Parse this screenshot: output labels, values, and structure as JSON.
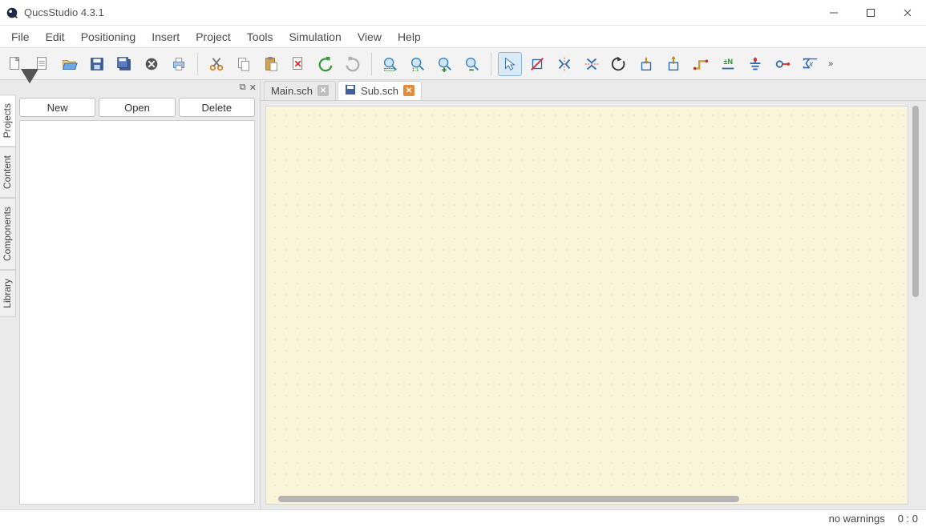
{
  "app": {
    "title": "QucsStudio 4.3.1"
  },
  "menu": {
    "file": "File",
    "edit": "Edit",
    "positioning": "Positioning",
    "insert": "Insert",
    "project": "Project",
    "tools": "Tools",
    "simulation": "Simulation",
    "view": "View",
    "help": "Help"
  },
  "toolbar_icons": {
    "new_doc": "new-document-icon",
    "new_doc_text": "new-text-document-icon",
    "open": "open-folder-icon",
    "save": "save-icon",
    "save_all": "save-all-icon",
    "close": "close-doc-icon",
    "print": "print-icon",
    "cut": "cut-icon",
    "copy": "copy-icon",
    "paste": "paste-icon",
    "delete": "delete-icon",
    "undo": "undo-icon",
    "redo": "redo-icon",
    "zoom_fit": "zoom-fit-icon",
    "zoom_actual": "zoom-actual-icon",
    "zoom_in": "zoom-in-icon",
    "zoom_out": "zoom-out-icon",
    "select": "select-pointer-icon",
    "deactivate": "deactivate-icon",
    "mirror_y": "mirror-y-icon",
    "mirror_x": "mirror-x-icon",
    "rotate": "rotate-icon",
    "align_top": "align-top-icon",
    "align_bottom": "align-bottom-icon",
    "wire": "wire-icon",
    "wire_label": "wire-label-icon",
    "ground": "ground-icon",
    "port": "port-icon",
    "equation": "equation-icon"
  },
  "side_tabs": {
    "projects": "Projects",
    "content": "Content",
    "components": "Components",
    "library": "Library"
  },
  "panel": {
    "new_btn": "New",
    "open_btn": "Open",
    "delete_btn": "Delete"
  },
  "tabs": {
    "0": {
      "label": "Main.sch"
    },
    "1": {
      "label": "Sub.sch"
    }
  },
  "status": {
    "warnings": "no warnings",
    "cursor": "0 : 0"
  },
  "dock_controls": {
    "float": "⧉",
    "close": "✕"
  }
}
